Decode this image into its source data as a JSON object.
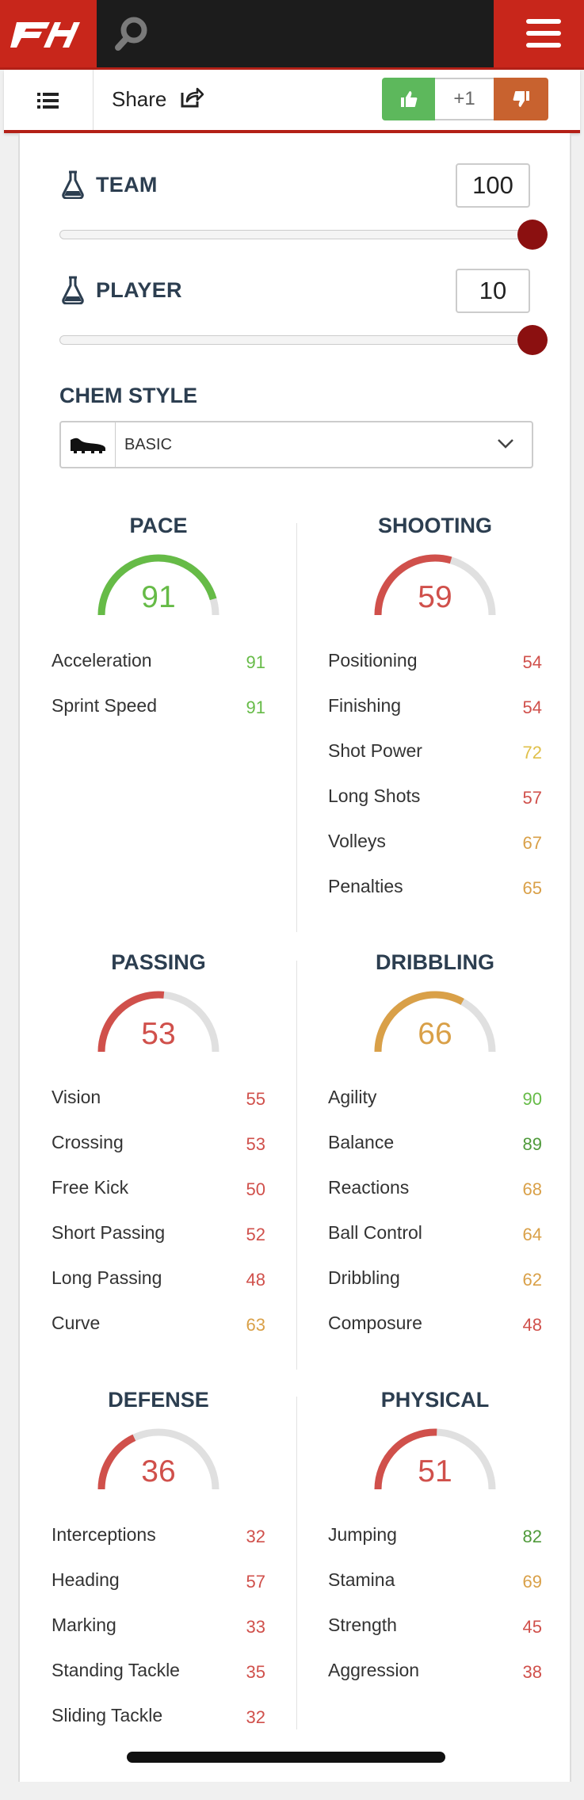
{
  "header": {
    "logo_text": "FH",
    "search_icon": "search-icon",
    "menu_icon": "hamburger-icon",
    "brand_color": "#c8261b"
  },
  "toolbar": {
    "share_label": "Share",
    "vote_count": "+1",
    "upvote_icon": "thumbs-up-icon",
    "downvote_icon": "thumbs-down-icon"
  },
  "chemistry": {
    "team_label": "TEAM",
    "team_value": "100",
    "team_level": 1.0,
    "player_label": "PLAYER",
    "player_value": "10",
    "player_level": 1.0,
    "style_title": "CHEM STYLE",
    "style_value": "BASIC",
    "style_icon": "boot-icon"
  },
  "colors": {
    "green": "#66bb47",
    "dark_green": "#4f9a3a",
    "yellow": "#e0b54a",
    "orange": "#d9a048",
    "red": "#d0504b"
  },
  "stats": [
    {
      "title": "PACE",
      "value": "91",
      "color": "#66bb47",
      "attributes": [
        {
          "label": "Acceleration",
          "value": "91",
          "color": "#66bb47"
        },
        {
          "label": "Sprint Speed",
          "value": "91",
          "color": "#66bb47"
        }
      ]
    },
    {
      "title": "SHOOTING",
      "value": "59",
      "color": "#d0504b",
      "attributes": [
        {
          "label": "Positioning",
          "value": "54",
          "color": "#d0504b"
        },
        {
          "label": "Finishing",
          "value": "54",
          "color": "#d0504b"
        },
        {
          "label": "Shot Power",
          "value": "72",
          "color": "#e0c04a"
        },
        {
          "label": "Long Shots",
          "value": "57",
          "color": "#d0504b"
        },
        {
          "label": "Volleys",
          "value": "67",
          "color": "#d9a048"
        },
        {
          "label": "Penalties",
          "value": "65",
          "color": "#d9a048"
        }
      ]
    },
    {
      "title": "PASSING",
      "value": "53",
      "color": "#d0504b",
      "attributes": [
        {
          "label": "Vision",
          "value": "55",
          "color": "#d0504b"
        },
        {
          "label": "Crossing",
          "value": "53",
          "color": "#d0504b"
        },
        {
          "label": "Free Kick",
          "value": "50",
          "color": "#d0504b"
        },
        {
          "label": "Short Passing",
          "value": "52",
          "color": "#d0504b"
        },
        {
          "label": "Long Passing",
          "value": "48",
          "color": "#d0504b"
        },
        {
          "label": "Curve",
          "value": "63",
          "color": "#d9a048"
        }
      ]
    },
    {
      "title": "DRIBBLING",
      "value": "66",
      "color": "#d9a048",
      "attributes": [
        {
          "label": "Agility",
          "value": "90",
          "color": "#66bb47"
        },
        {
          "label": "Balance",
          "value": "89",
          "color": "#4f9a3a"
        },
        {
          "label": "Reactions",
          "value": "68",
          "color": "#d9a048"
        },
        {
          "label": "Ball Control",
          "value": "64",
          "color": "#d9a048"
        },
        {
          "label": "Dribbling",
          "value": "62",
          "color": "#d9a048"
        },
        {
          "label": "Composure",
          "value": "48",
          "color": "#d0504b"
        }
      ]
    },
    {
      "title": "DEFENSE",
      "value": "36",
      "color": "#d0504b",
      "attributes": [
        {
          "label": "Interceptions",
          "value": "32",
          "color": "#d0504b"
        },
        {
          "label": "Heading",
          "value": "57",
          "color": "#d0504b"
        },
        {
          "label": "Marking",
          "value": "33",
          "color": "#d0504b"
        },
        {
          "label": "Standing Tackle",
          "value": "35",
          "color": "#d0504b"
        },
        {
          "label": "Sliding Tackle",
          "value": "32",
          "color": "#d0504b"
        }
      ]
    },
    {
      "title": "PHYSICAL",
      "value": "51",
      "color": "#d0504b",
      "attributes": [
        {
          "label": "Jumping",
          "value": "82",
          "color": "#4f9a3a"
        },
        {
          "label": "Stamina",
          "value": "69",
          "color": "#d9a048"
        },
        {
          "label": "Strength",
          "value": "45",
          "color": "#d0504b"
        },
        {
          "label": "Aggression",
          "value": "38",
          "color": "#d0504b"
        }
      ]
    }
  ]
}
